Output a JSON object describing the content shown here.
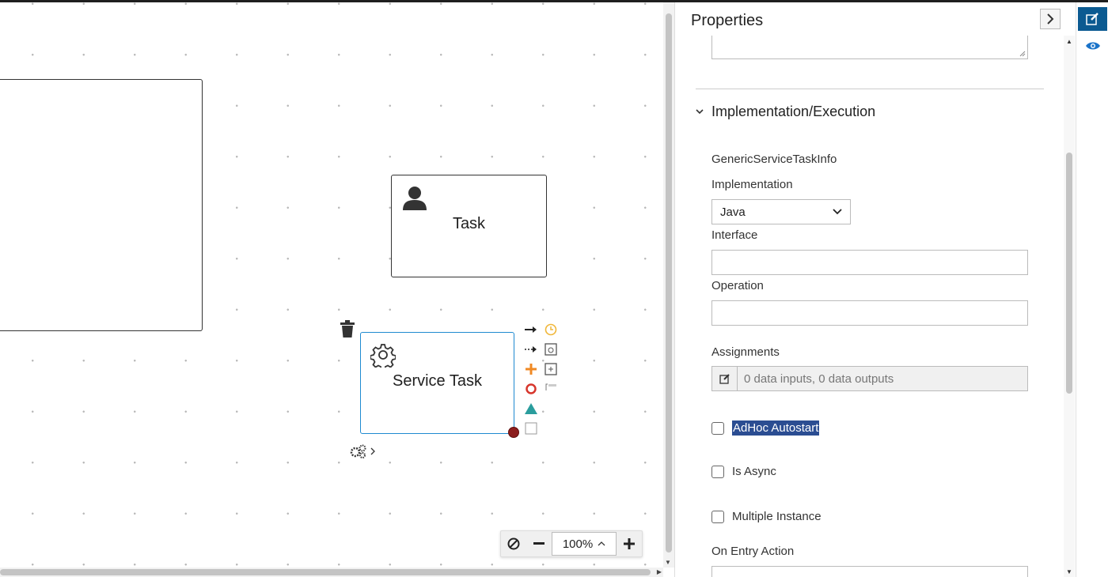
{
  "canvas": {
    "task_label": "Task",
    "service_task_label": "Service Task",
    "zoom": {
      "value": "100%"
    }
  },
  "properties": {
    "title": "Properties",
    "section_title": "Implementation/Execution",
    "generic_info_label": "GenericServiceTaskInfo",
    "implementation_label": "Implementation",
    "implementation_value": "Java",
    "interface_label": "Interface",
    "interface_value": "",
    "operation_label": "Operation",
    "operation_value": "",
    "assignments_label": "Assignments",
    "assignments_value": "0 data inputs, 0 data outputs",
    "adhoc_label": "AdHoc Autostart",
    "async_label": "Is Async",
    "multiple_label": "Multiple Instance",
    "on_entry_label": "On Entry Action"
  },
  "colors": {
    "selected_border": "#1f8ad0",
    "accent": "#0b5a91",
    "highlight": "#2b4d92",
    "palette_orange": "#f08a24",
    "palette_red": "#d7362c",
    "palette_teal": "#2a9d9d",
    "palette_yellow": "#f0b73a"
  },
  "icons": [
    "user-icon",
    "gear-icon",
    "trash-icon",
    "edit-icon",
    "eye-icon",
    "chevron-right-icon",
    "chevron-down-icon",
    "ban-icon",
    "minus-icon",
    "plus-icon"
  ]
}
